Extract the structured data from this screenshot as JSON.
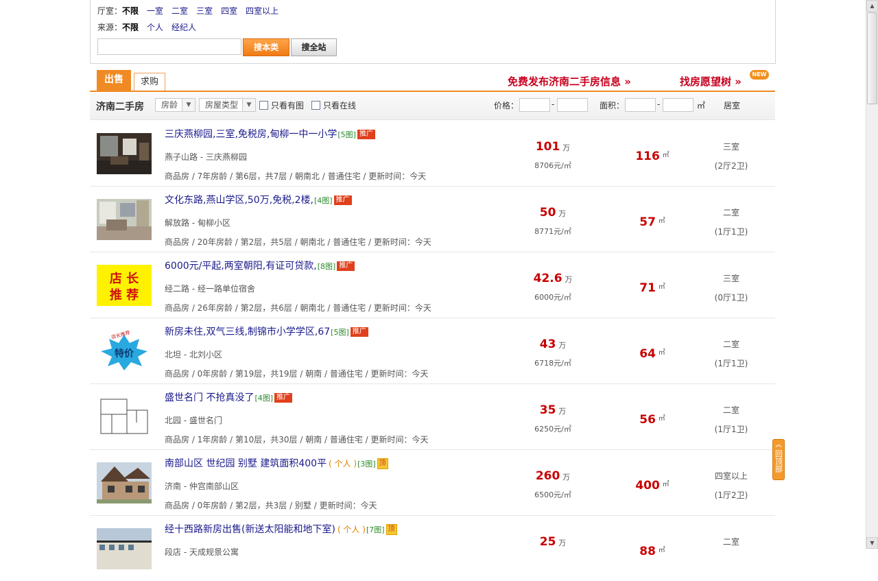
{
  "filters": {
    "rooms": {
      "label": "厅室：",
      "selected": "不限",
      "options": [
        "一室",
        "二室",
        "三室",
        "四室",
        "四室以上"
      ]
    },
    "source": {
      "label": "来源：",
      "selected": "不限",
      "options": [
        "个人",
        "经纪人"
      ]
    },
    "search": {
      "value": "",
      "btn_category": "搜本类",
      "btn_site": "搜全站"
    }
  },
  "tabs": {
    "sell": "出售",
    "buy": "求购"
  },
  "promo": {
    "publish": "免费发布济南二手房信息 »",
    "wish": "找房愿望树 »",
    "new_badge": "NEW"
  },
  "sortbar": {
    "title": "济南二手房",
    "age_dropdown": "房龄",
    "type_dropdown": "房屋类型",
    "has_photo": "只看有图",
    "online": "只看在线",
    "price_label": "价格：",
    "dash": "-",
    "area_label": "面积：",
    "area_unit": "㎡",
    "rooms_col": "居室"
  },
  "listings": [
    {
      "title": "三庆燕柳园,三室,免税房,甸柳一中一小学",
      "photos": "[5图]",
      "badge": "推广",
      "person": "",
      "address": "燕子山路 - 三庆燕柳园",
      "meta": "商品房 / 7年房龄 / 第6层，共7层 / 朝南北 / 普通住宅 / 更新时间：今天",
      "price": "101",
      "price_unit": "万",
      "unit_price": "8706元/㎡",
      "area": "116",
      "area_unit": "㎡",
      "rooms": "三室",
      "halls": "(2厅2卫)"
    },
    {
      "title": "文化东路,燕山学区,50万,免税,2楼,",
      "photos": "[4图]",
      "badge": "推广",
      "person": "",
      "address": "解放路 - 甸柳小区",
      "meta": "商品房 / 20年房龄 / 第2层，共5层 / 朝南北 / 普通住宅 / 更新时间：今天",
      "price": "50",
      "price_unit": "万",
      "unit_price": "8771元/㎡",
      "area": "57",
      "area_unit": "㎡",
      "rooms": "二室",
      "halls": "(1厅1卫)"
    },
    {
      "title": "6000元/平起,两室朝阳,有证可贷款,",
      "photos": "[8图]",
      "badge": "推广",
      "person": "",
      "address": "经二路 - 经一路单位宿舍",
      "meta": "商品房 / 26年房龄 / 第2层，共6层 / 朝南北 / 普通住宅 / 更新时间：今天",
      "price": "42.6",
      "price_unit": "万",
      "unit_price": "6000元/㎡",
      "area": "71",
      "area_unit": "㎡",
      "rooms": "三室",
      "halls": "(0厅1卫)"
    },
    {
      "title": "新房未住,双气三线,制锦市小学学区,67",
      "photos": "[5图]",
      "badge": "推广",
      "person": "",
      "address": "北坦 - 北刘小区",
      "meta": "商品房 / 0年房龄 / 第19层，共19层 / 朝南 / 普通住宅 / 更新时间：今天",
      "price": "43",
      "price_unit": "万",
      "unit_price": "6718元/㎡",
      "area": "64",
      "area_unit": "㎡",
      "rooms": "二室",
      "halls": "(1厅1卫)"
    },
    {
      "title": "盛世名门 不抢真没了",
      "photos": "[4图]",
      "badge": "推广",
      "person": "",
      "address": "北园 - 盛世名门",
      "meta": "商品房 / 1年房龄 / 第10层，共30层 / 朝南 / 普通住宅 / 更新时间：今天",
      "price": "35",
      "price_unit": "万",
      "unit_price": "6250元/㎡",
      "area": "56",
      "area_unit": "㎡",
      "rooms": "二室",
      "halls": "(1厅1卫)"
    },
    {
      "title": "南部山区 世纪园 别墅 建筑面积400平",
      "photos": "[3图]",
      "badge": "顶",
      "person": "( 个人 )",
      "address": "济南 - 仲宫南部山区",
      "meta": "商品房 / 0年房龄 / 第2层，共3层 / 别墅 / 更新时间：今天",
      "price": "260",
      "price_unit": "万",
      "unit_price": "6500元/㎡",
      "area": "400",
      "area_unit": "㎡",
      "rooms": "四室以上",
      "halls": "(1厅2卫)"
    },
    {
      "title": "经十西路新房出售(新送太阳能和地下室)",
      "photos": "[7图]",
      "badge": "顶",
      "person": "( 个人 )",
      "address": "段店 - 天成规景公寓",
      "meta": "",
      "price": "25",
      "price_unit": "万",
      "unit_price": "",
      "area": "88",
      "area_unit": "㎡",
      "rooms": "二室",
      "halls": ""
    }
  ],
  "thumb_texts": {
    "shop_line1": "店 长",
    "shop_line2": "推 荐",
    "sale": "特价",
    "sale_small": "店长推荐"
  },
  "backtop": "回顶部",
  "scroll_arrows": {
    "up": "▲",
    "down": "▼"
  }
}
